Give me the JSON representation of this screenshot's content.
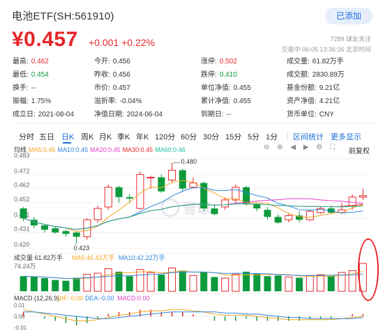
{
  "header": {
    "title": "电池ETF(SH:561910)",
    "add_button": "已添加"
  },
  "quote_head": {
    "price": "¥0.457",
    "change": "+0.001",
    "change_pct": "+0.22%",
    "followers": "7289 球友关注",
    "trade_info": "交易中 06-05 13:36:36 北京时间"
  },
  "stats": [
    [
      {
        "label": "最高:",
        "value": "0.462",
        "color": "red"
      },
      {
        "label": "今开:",
        "value": "0.456",
        "color": ""
      },
      {
        "label": "涨停:",
        "value": "0.502",
        "color": "red"
      },
      {
        "label": "成交量:",
        "value": "61.82万手",
        "color": ""
      }
    ],
    [
      {
        "label": "最低:",
        "value": "0.454",
        "color": "green"
      },
      {
        "label": "昨收:",
        "value": "0.456",
        "color": ""
      },
      {
        "label": "跌停:",
        "value": "0.410",
        "color": "green"
      },
      {
        "label": "成交额:",
        "value": "2830.89万",
        "color": ""
      }
    ],
    [
      {
        "label": "换手:",
        "value": "--",
        "color": ""
      },
      {
        "label": "市价:",
        "value": "0.457",
        "color": ""
      },
      {
        "label": "单位净值:",
        "value": "0.455",
        "color": ""
      },
      {
        "label": "基金份额:",
        "value": "9.21亿",
        "color": ""
      }
    ],
    [
      {
        "label": "振幅:",
        "value": "1.75%",
        "color": ""
      },
      {
        "label": "溢折率:",
        "value": "-0.04%",
        "color": ""
      },
      {
        "label": "累计净值:",
        "value": "0.455",
        "color": ""
      },
      {
        "label": "资产净值:",
        "value": "4.21亿",
        "color": ""
      }
    ],
    [
      {
        "label": "成立日:",
        "value": "2021-08-04",
        "color": ""
      },
      {
        "label": "净值日期:",
        "value": "2024-06-04",
        "color": ""
      },
      {
        "label": "到期日:",
        "value": "--",
        "color": ""
      },
      {
        "label": "货币单位:",
        "value": "CNY",
        "color": ""
      }
    ]
  ],
  "periods": [
    "分时",
    "五日",
    "日K",
    "周K",
    "月K",
    "季K",
    "年K",
    "120分",
    "60分",
    "30分",
    "15分",
    "5分",
    "1分"
  ],
  "active_period": "日K",
  "period_links": [
    "区间统计",
    "更多显示"
  ],
  "ma_legend": {
    "label": "均线",
    "items": [
      {
        "text": "MA5:0.45",
        "color": "#f5a623"
      },
      {
        "text": "MA10:0.45",
        "color": "#2e86de"
      },
      {
        "text": "MA20:0.45",
        "color": "#e040c8"
      },
      {
        "text": "MA30:0.45",
        "color": "#e5262a"
      },
      {
        "text": "MA60:0.46",
        "color": "#1abc9c"
      }
    ],
    "adjust": "前复权"
  },
  "vol_legend": {
    "label": "成交量 61.82万手",
    "ma5": "MA5:46.43万手",
    "ma10": "MA10:42.22万手",
    "top": "74.24万"
  },
  "macd_legend": {
    "label": "MACD (12,26,9)",
    "dif": "DIF:-0.00",
    "dea": "DEA:-0.00",
    "macd": "MACD:0.00"
  },
  "watermark": "雪球",
  "colors": {
    "up": "#e5262a",
    "down": "#0d9a3c",
    "accent": "#1a6fd8"
  },
  "chart_data": {
    "type": "candlestick",
    "y_ticks": [
      "0.483",
      "0.472",
      "0.462",
      "0.452",
      "0.441",
      "0.431",
      "0.420"
    ],
    "ylim": [
      0.42,
      0.483
    ],
    "high_label": "0.480",
    "low_label": "0.423",
    "candles": [
      {
        "o": 0.448,
        "c": 0.441,
        "h": 0.449,
        "l": 0.439
      },
      {
        "o": 0.44,
        "c": 0.436,
        "h": 0.442,
        "l": 0.434
      },
      {
        "o": 0.436,
        "c": 0.433,
        "h": 0.437,
        "l": 0.431
      },
      {
        "o": 0.434,
        "c": 0.431,
        "h": 0.435,
        "l": 0.43
      },
      {
        "o": 0.432,
        "c": 0.43,
        "h": 0.433,
        "l": 0.428
      },
      {
        "o": 0.431,
        "c": 0.428,
        "h": 0.432,
        "l": 0.423
      },
      {
        "o": 0.428,
        "c": 0.44,
        "h": 0.441,
        "l": 0.426
      },
      {
        "o": 0.44,
        "c": 0.448,
        "h": 0.45,
        "l": 0.438
      },
      {
        "o": 0.449,
        "c": 0.463,
        "h": 0.465,
        "l": 0.447
      },
      {
        "o": 0.463,
        "c": 0.456,
        "h": 0.464,
        "l": 0.452
      },
      {
        "o": 0.456,
        "c": 0.455,
        "h": 0.458,
        "l": 0.452
      },
      {
        "o": 0.448,
        "c": 0.472,
        "h": 0.474,
        "l": 0.447
      },
      {
        "o": 0.47,
        "c": 0.47,
        "h": 0.471,
        "l": 0.462
      },
      {
        "o": 0.47,
        "c": 0.46,
        "h": 0.472,
        "l": 0.459
      },
      {
        "o": 0.468,
        "c": 0.475,
        "h": 0.48,
        "l": 0.466
      },
      {
        "o": 0.475,
        "c": 0.462,
        "h": 0.476,
        "l": 0.46
      },
      {
        "o": 0.463,
        "c": 0.466,
        "h": 0.47,
        "l": 0.462
      },
      {
        "o": 0.466,
        "c": 0.448,
        "h": 0.467,
        "l": 0.446
      },
      {
        "o": 0.448,
        "c": 0.444,
        "h": 0.45,
        "l": 0.443
      },
      {
        "o": 0.449,
        "c": 0.454,
        "h": 0.456,
        "l": 0.447
      },
      {
        "o": 0.454,
        "c": 0.463,
        "h": 0.465,
        "l": 0.452
      },
      {
        "o": 0.463,
        "c": 0.451,
        "h": 0.464,
        "l": 0.45
      },
      {
        "o": 0.451,
        "c": 0.448,
        "h": 0.452,
        "l": 0.446
      },
      {
        "o": 0.447,
        "c": 0.442,
        "h": 0.449,
        "l": 0.44
      },
      {
        "o": 0.442,
        "c": 0.438,
        "h": 0.444,
        "l": 0.437
      },
      {
        "o": 0.44,
        "c": 0.443,
        "h": 0.445,
        "l": 0.438
      },
      {
        "o": 0.443,
        "c": 0.44,
        "h": 0.446,
        "l": 0.438
      },
      {
        "o": 0.44,
        "c": 0.446,
        "h": 0.447,
        "l": 0.439
      },
      {
        "o": 0.445,
        "c": 0.448,
        "h": 0.449,
        "l": 0.444
      },
      {
        "o": 0.448,
        "c": 0.445,
        "h": 0.45,
        "l": 0.444
      },
      {
        "o": 0.445,
        "c": 0.447,
        "h": 0.452,
        "l": 0.444
      },
      {
        "o": 0.45,
        "c": 0.456,
        "h": 0.458,
        "l": 0.447
      },
      {
        "o": 0.456,
        "c": 0.457,
        "h": 0.462,
        "l": 0.454
      }
    ],
    "volumes": [
      40,
      38,
      35,
      30,
      28,
      36,
      45,
      48,
      60,
      52,
      40,
      58,
      50,
      44,
      62,
      55,
      42,
      50,
      38,
      35,
      45,
      52,
      48,
      40,
      42,
      38,
      36,
      42,
      44,
      40,
      50,
      55,
      74
    ],
    "macd_lines": {
      "dif": [
        0.006,
        0.004,
        0.002,
        0.0,
        -0.002,
        -0.004,
        -0.004,
        -0.003,
        -0.001,
        0.001,
        0.002,
        0.004,
        0.005,
        0.005,
        0.006,
        0.006,
        0.005,
        0.004,
        0.002,
        0.001,
        0.001,
        0.001,
        0.0,
        -0.001,
        -0.002,
        -0.003,
        -0.003,
        -0.003,
        -0.003,
        -0.003,
        -0.002,
        -0.001,
        0.0
      ],
      "dea": [
        0.004,
        0.004,
        0.003,
        0.002,
        0.001,
        0.0,
        -0.001,
        -0.002,
        -0.002,
        -0.001,
        0.0,
        0.001,
        0.002,
        0.003,
        0.004,
        0.004,
        0.004,
        0.004,
        0.004,
        0.003,
        0.003,
        0.002,
        0.002,
        0.001,
        0.0,
        -0.001,
        -0.001,
        -0.002,
        -0.002,
        -0.002,
        -0.002,
        -0.002,
        -0.001
      ]
    },
    "macd_ticks": [
      "0.01",
      "0.00",
      "-0.01"
    ]
  }
}
